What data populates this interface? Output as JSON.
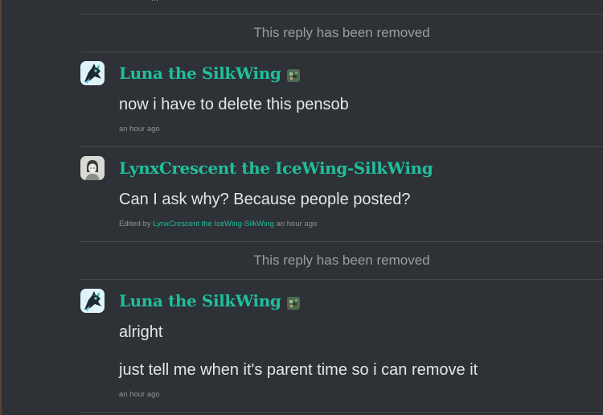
{
  "thread": {
    "top_fragment": "...",
    "removed_label": "This reply has been removed",
    "replies": [
      {
        "author": "Luna the SilkWing",
        "badge": "pixel-dragon-badge-icon",
        "avatar": "dragon-avatar",
        "paragraphs": [
          "now i have to delete this pensob"
        ],
        "time": "an hour ago"
      },
      {
        "author": "LynxCrescent the IceWing-SilkWing",
        "avatar": "portrait-avatar",
        "paragraphs": [
          "Can I ask why? Because people posted?"
        ],
        "edited_prefix": "Edited by",
        "edited_by": "LynxCrescent the IceWing-SilkWing",
        "time": "an hour ago"
      },
      {
        "author": "Luna the SilkWing",
        "badge": "pixel-dragon-badge-icon",
        "avatar": "dragon-avatar",
        "paragraphs": [
          "alright",
          "just tell me when it's parent time so i can remove it"
        ],
        "time": "an hour ago"
      }
    ]
  },
  "colors": {
    "background": "#2e3135",
    "author_link": "#1fbf9d",
    "body_text": "#e4e6e8",
    "muted_text": "#9a9ea3",
    "divider": "#45494e"
  }
}
